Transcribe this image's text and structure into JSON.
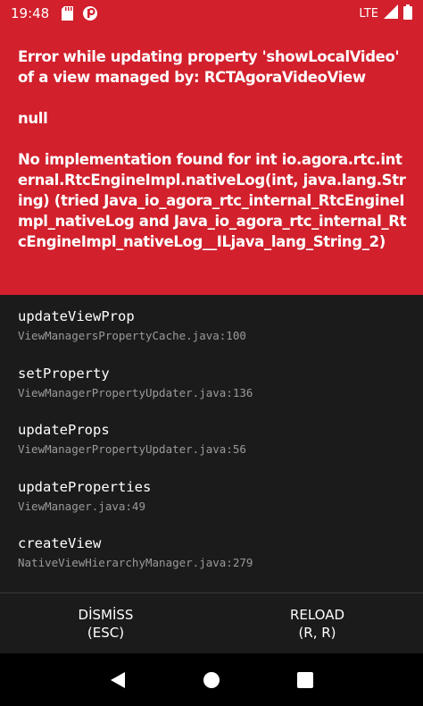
{
  "status_bar": {
    "time": "19:48",
    "network": "LTE",
    "icons": [
      "sd-card-icon",
      "app-notification-icon",
      "lte-signal-icon",
      "battery-icon"
    ]
  },
  "error": {
    "title": "Error while updating property 'showLocalVideo' of a view managed by: RCTAgoraVideoView",
    "detail": "null",
    "message": "No implementation found for int io.agora.rtc.internal.RtcEngineImpl.nativeLog(int, java.lang.String) (tried Java_io_agora_rtc_internal_RtcEngineImpl_nativeLog and Java_io_agora_rtc_internal_RtcEngineImpl_nativeLog__ILjava_lang_String_2)"
  },
  "stack": [
    {
      "method": "updateViewProp",
      "file": "ViewManagersPropertyCache.java:100"
    },
    {
      "method": "setProperty",
      "file": "ViewManagerPropertyUpdater.java:136"
    },
    {
      "method": "updateProps",
      "file": "ViewManagerPropertyUpdater.java:56"
    },
    {
      "method": "updateProperties",
      "file": "ViewManager.java:49"
    },
    {
      "method": "createView",
      "file": "NativeViewHierarchyManager.java:279"
    }
  ],
  "buttons": {
    "dismiss_label": "DİSMİSS",
    "dismiss_shortcut": "(ESC)",
    "reload_label": "RELOAD",
    "reload_shortcut": "(R, R)"
  },
  "nav": {
    "icons": [
      "back-icon",
      "home-icon",
      "recents-icon"
    ]
  },
  "colors": {
    "error_red": "#d2202c",
    "stack_bg": "#1b1b1b",
    "file_gray": "#9a9a9a"
  }
}
